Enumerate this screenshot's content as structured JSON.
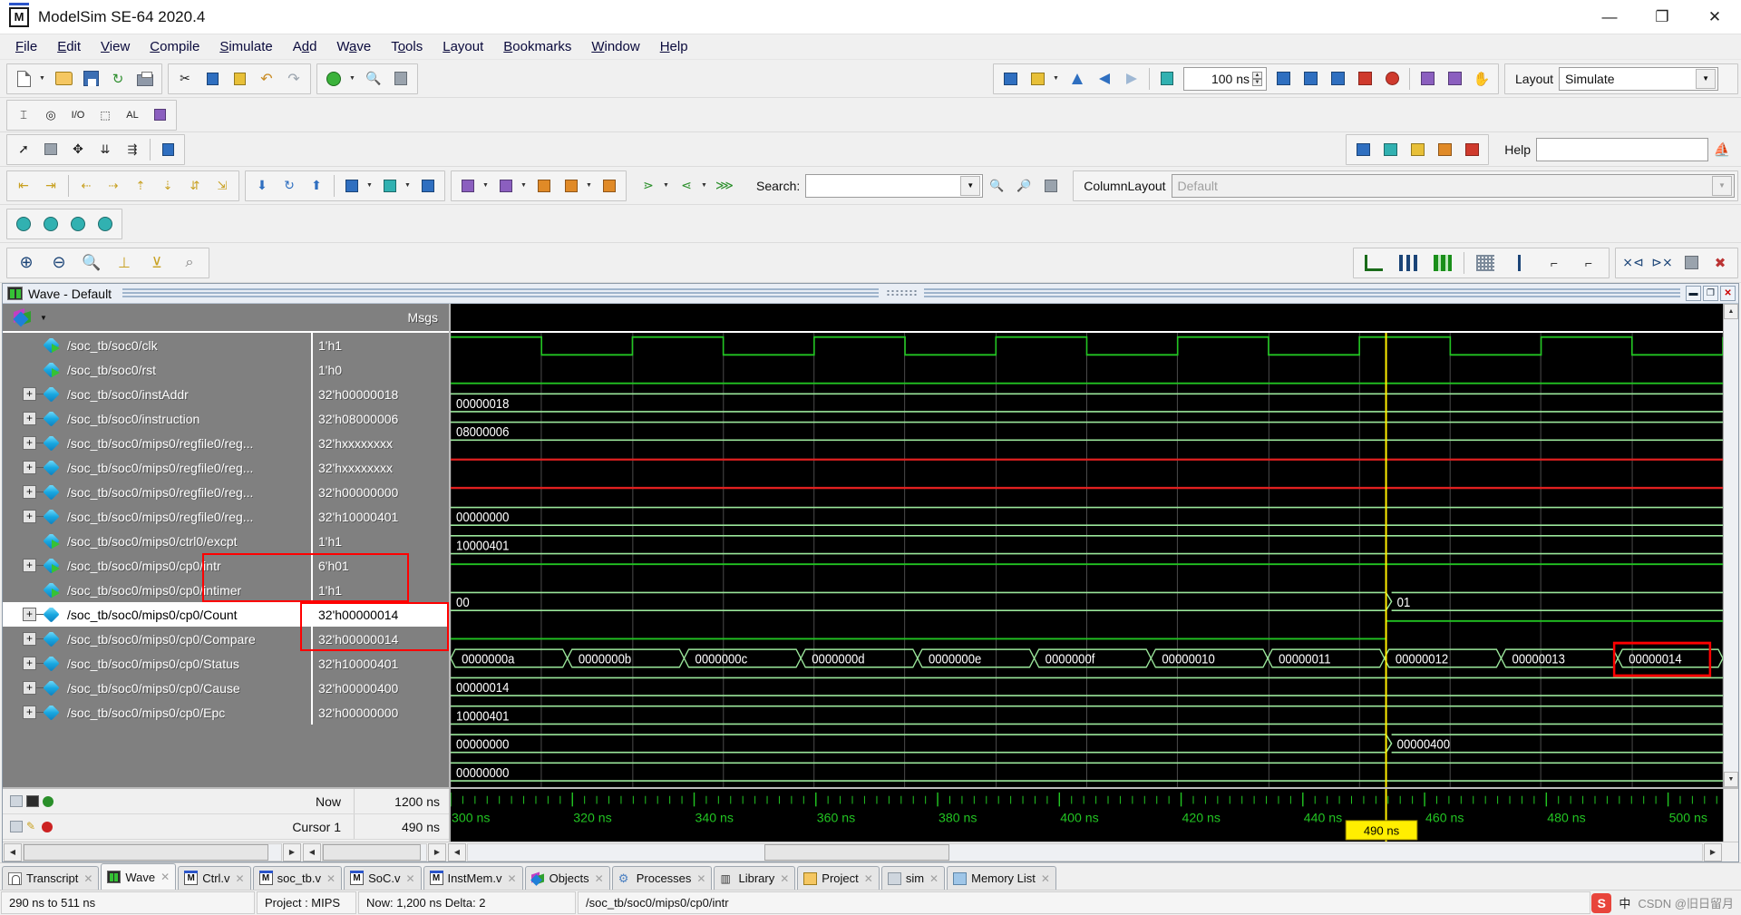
{
  "window": {
    "title": "ModelSim SE-64 2020.4",
    "app_icon": "M",
    "minimize": "—",
    "maximize": "❐",
    "close": "✕"
  },
  "menubar": [
    {
      "label": "File",
      "mnemonic": "F"
    },
    {
      "label": "Edit",
      "mnemonic": "E"
    },
    {
      "label": "View",
      "mnemonic": "V"
    },
    {
      "label": "Compile",
      "mnemonic": "C"
    },
    {
      "label": "Simulate",
      "mnemonic": "S"
    },
    {
      "label": "Add",
      "mnemonic": "d"
    },
    {
      "label": "Wave",
      "mnemonic": "a"
    },
    {
      "label": "Tools",
      "mnemonic": "o"
    },
    {
      "label": "Layout",
      "mnemonic": "L"
    },
    {
      "label": "Bookmarks",
      "mnemonic": "B"
    },
    {
      "label": "Window",
      "mnemonic": "W"
    },
    {
      "label": "Help",
      "mnemonic": "H"
    }
  ],
  "toolbar": {
    "run_time_value": "100 ns",
    "layout_label": "Layout",
    "layout_value": "Simulate",
    "help_label": "Help",
    "help_value": "",
    "search_label": "Search:",
    "search_value": "",
    "columnlayout_label": "ColumnLayout",
    "columnlayout_value": "Default"
  },
  "wave_window": {
    "title": "Wave - Default",
    "msgs_header": "Msgs",
    "minimize": "▬",
    "restore": "❐",
    "close": "✕"
  },
  "signals": [
    {
      "name": "/soc_tb/soc0/clk",
      "value": "1'h1",
      "expandable": false,
      "io": true,
      "selected": false
    },
    {
      "name": "/soc_tb/soc0/rst",
      "value": "1'h0",
      "expandable": false,
      "io": true,
      "selected": false
    },
    {
      "name": "/soc_tb/soc0/instAddr",
      "value": "32'h00000018",
      "expandable": true,
      "io": false,
      "selected": false
    },
    {
      "name": "/soc_tb/soc0/instruction",
      "value": "32'h08000006",
      "expandable": true,
      "io": false,
      "selected": false
    },
    {
      "name": "/soc_tb/soc0/mips0/regfile0/reg...",
      "value": "32'hxxxxxxxx",
      "expandable": true,
      "io": false,
      "selected": false
    },
    {
      "name": "/soc_tb/soc0/mips0/regfile0/reg...",
      "value": "32'hxxxxxxxx",
      "expandable": true,
      "io": false,
      "selected": false
    },
    {
      "name": "/soc_tb/soc0/mips0/regfile0/reg...",
      "value": "32'h00000000",
      "expandable": true,
      "io": false,
      "selected": false
    },
    {
      "name": "/soc_tb/soc0/mips0/regfile0/reg...",
      "value": "32'h10000401",
      "expandable": true,
      "io": false,
      "selected": false
    },
    {
      "name": "/soc_tb/soc0/mips0/ctrl0/excpt",
      "value": "1'h1",
      "expandable": false,
      "io": true,
      "selected": false
    },
    {
      "name": "/soc_tb/soc0/mips0/cp0/intr",
      "value": "6'h01",
      "expandable": true,
      "io": true,
      "selected": false
    },
    {
      "name": "/soc_tb/soc0/mips0/cp0/intimer",
      "value": "1'h1",
      "expandable": false,
      "io": true,
      "selected": false
    },
    {
      "name": "/soc_tb/soc0/mips0/cp0/Count",
      "value": "32'h00000014",
      "expandable": true,
      "io": false,
      "selected": true
    },
    {
      "name": "/soc_tb/soc0/mips0/cp0/Compare",
      "value": "32'h00000014",
      "expandable": true,
      "io": false,
      "selected": false
    },
    {
      "name": "/soc_tb/soc0/mips0/cp0/Status",
      "value": "32'h10000401",
      "expandable": true,
      "io": false,
      "selected": false
    },
    {
      "name": "/soc_tb/soc0/mips0/cp0/Cause",
      "value": "32'h00000400",
      "expandable": true,
      "io": false,
      "selected": false
    },
    {
      "name": "/soc_tb/soc0/mips0/cp0/Epc",
      "value": "32'h00000000",
      "expandable": true,
      "io": false,
      "selected": false
    }
  ],
  "waveform": {
    "bus_labels": {
      "instAddr": "00000018",
      "instruction": "08000006",
      "reg_zero": "00000000",
      "reg_status": "10000401",
      "intr": "00",
      "intr_right": "01",
      "compare": "00000014",
      "status": "10000401",
      "cause_left": "00000000",
      "cause_right": "00000400",
      "epc": "00000000"
    },
    "count_segments": [
      "0000000a",
      "0000000b",
      "0000000c",
      "0000000d",
      "0000000e",
      "0000000f",
      "00000010",
      "00000011",
      "00000012",
      "00000013",
      "00000014"
    ],
    "time_ticks": [
      "300 ns",
      "320 ns",
      "340 ns",
      "360 ns",
      "380 ns",
      "400 ns",
      "420 ns",
      "440 ns",
      "460 ns",
      "480 ns",
      "500 ns"
    ],
    "cursor_marker_label": "490 ns",
    "colors": {
      "signal_green": "#22c422",
      "bus_green": "#9be79b",
      "error_red": "#e02020",
      "cursor_yellow": "#ffee00",
      "highlight_red": "#ff0000",
      "text_white": "#ffffff"
    }
  },
  "cursor_panel": {
    "now_label": "Now",
    "now_value": "1200 ns",
    "cursor_label": "Cursor 1",
    "cursor_value": "490 ns"
  },
  "tabs": [
    {
      "label": "Transcript",
      "icon": "transcript",
      "active": false,
      "closable": true
    },
    {
      "label": "Wave",
      "icon": "wave",
      "active": true,
      "closable": true
    },
    {
      "label": "Ctrl.v",
      "icon": "vfile",
      "active": false,
      "closable": true
    },
    {
      "label": "soc_tb.v",
      "icon": "vfile",
      "active": false,
      "closable": true
    },
    {
      "label": "SoC.v",
      "icon": "vfile",
      "active": false,
      "closable": true
    },
    {
      "label": "InstMem.v",
      "icon": "vfile",
      "active": false,
      "closable": true
    },
    {
      "label": "Objects",
      "icon": "objects",
      "active": false,
      "closable": true
    },
    {
      "label": "Processes",
      "icon": "gear",
      "active": false,
      "closable": true
    },
    {
      "label": "Library",
      "icon": "library",
      "active": false,
      "closable": true
    },
    {
      "label": "Project",
      "icon": "project",
      "active": false,
      "closable": true
    },
    {
      "label": "sim",
      "icon": "sim",
      "active": false,
      "closable": true
    },
    {
      "label": "Memory List",
      "icon": "memory",
      "active": false,
      "closable": true
    }
  ],
  "statusbar": {
    "range": "290 ns to 511 ns",
    "project": "Project : MIPS",
    "now_delta": "Now: 1,200 ns  Delta: 2",
    "path": "/soc_tb/soc0/mips0/cp0/intr",
    "tray_ime": "中",
    "tray_text": "CSDN @旧日留月"
  }
}
